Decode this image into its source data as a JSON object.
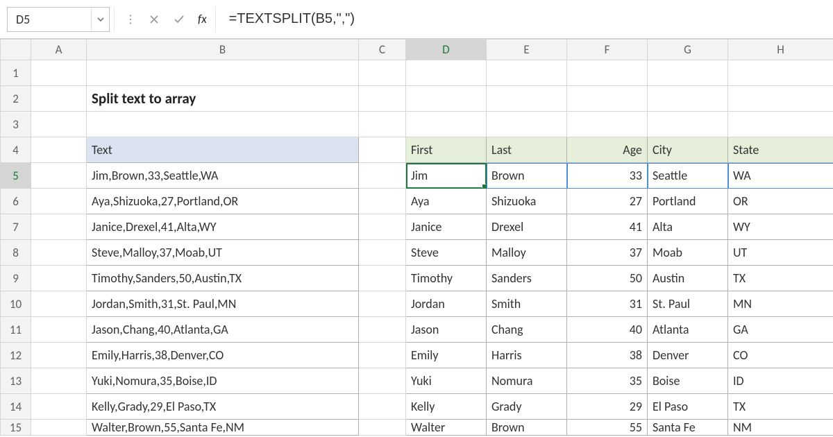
{
  "formula_bar": {
    "cell_ref": "D5",
    "fx_label": "fx",
    "formula": "=TEXTSPLIT(B5,\",\")"
  },
  "columns": [
    "A",
    "B",
    "C",
    "D",
    "E",
    "F",
    "G",
    "H"
  ],
  "row_numbers": [
    "1",
    "2",
    "3",
    "4",
    "5",
    "6",
    "7",
    "8",
    "9",
    "10",
    "11",
    "12",
    "13",
    "14",
    "15"
  ],
  "title": "Split text to array",
  "headers_left": {
    "text": "Text"
  },
  "headers_right": {
    "first": "First",
    "last": "Last",
    "age": "Age",
    "city": "City",
    "state": "State"
  },
  "rows": [
    {
      "text": "Jim,Brown,33,Seattle,WA",
      "first": "Jim",
      "last": "Brown",
      "age": "33",
      "city": "Seattle",
      "state": "WA"
    },
    {
      "text": "Aya,Shizuoka,27,Portland,OR",
      "first": "Aya",
      "last": "Shizuoka",
      "age": "27",
      "city": "Portland",
      "state": "OR"
    },
    {
      "text": "Janice,Drexel,41,Alta,WY",
      "first": "Janice",
      "last": "Drexel",
      "age": "41",
      "city": "Alta",
      "state": "WY"
    },
    {
      "text": "Steve,Malloy,37,Moab,UT",
      "first": "Steve",
      "last": "Malloy",
      "age": "37",
      "city": "Moab",
      "state": "UT"
    },
    {
      "text": "Timothy,Sanders,50,Austin,TX",
      "first": "Timothy",
      "last": "Sanders",
      "age": "50",
      "city": "Austin",
      "state": "TX"
    },
    {
      "text": "Jordan,Smith,31,St. Paul,MN",
      "first": "Jordan",
      "last": "Smith",
      "age": "31",
      "city": "St. Paul",
      "state": "MN"
    },
    {
      "text": "Jason,Chang,40,Atlanta,GA",
      "first": "Jason",
      "last": "Chang",
      "age": "40",
      "city": "Atlanta",
      "state": "GA"
    },
    {
      "text": "Emily,Harris,38,Denver,CO",
      "first": "Emily",
      "last": "Harris",
      "age": "38",
      "city": "Denver",
      "state": "CO"
    },
    {
      "text": "Yuki,Nomura,35,Boise,ID",
      "first": "Yuki",
      "last": "Nomura",
      "age": "35",
      "city": "Boise",
      "state": "ID"
    },
    {
      "text": "Kelly,Grady,29,El Paso,TX",
      "first": "Kelly",
      "last": "Grady",
      "age": "29",
      "city": "El Paso",
      "state": "TX"
    },
    {
      "text": "Walter,Brown,55,Santa Fe,NM",
      "first": "Walter",
      "last": "Brown",
      "age": "55",
      "city": "Santa Fe",
      "state": "NM"
    }
  ]
}
